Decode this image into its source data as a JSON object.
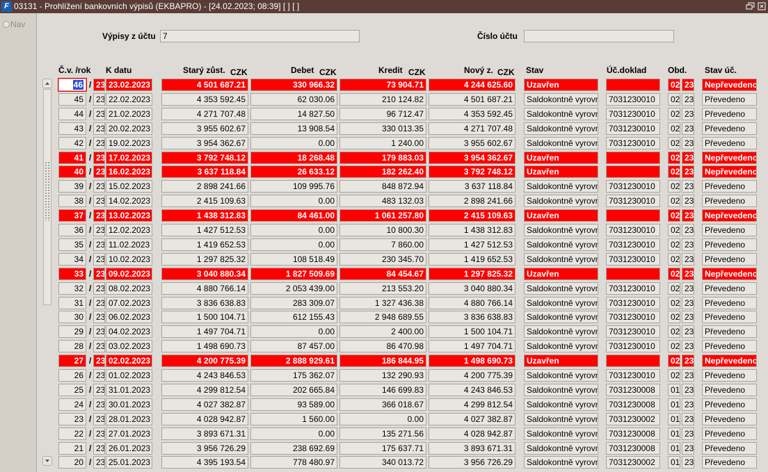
{
  "window": {
    "title": "03131 - Prohlížení bankovních výpisů (EKBAPRO) - [24.02.2023; 08:39]  [ ]  [ ]",
    "app_icon": "F"
  },
  "nav": {
    "label": "Nav"
  },
  "header": {
    "vypisy_label": "Výpisy z účtu",
    "vypisy_value": "7",
    "cislo_label": "Číslo účtu",
    "cislo_value": ""
  },
  "columns": {
    "cv": "Č.v. /rok",
    "kdatu": "K datu",
    "stary": "Starý zůst.",
    "stary_cur": "CZK",
    "debet": "Debet",
    "debet_cur": "CZK",
    "kredit": "Kredit",
    "kredit_cur": "CZK",
    "novy": "Nový z.",
    "novy_cur": "CZK",
    "stav": "Stav",
    "ucdoklad": "Úč.doklad",
    "obd": "Obd.",
    "stavuc": "Stav úč."
  },
  "rows": [
    {
      "cv": "46",
      "rok": "23",
      "date": "23.02.2023",
      "stary": "4 501 687.21",
      "debet": "330 966.32",
      "kredit": "73 904.71",
      "novy": "4 244 625.60",
      "stav": "Uzavřen",
      "doklad": "",
      "obd": "02",
      "obd_rok": "23",
      "stavuc": "Nepřevedeno",
      "hl": true
    },
    {
      "cv": "45",
      "rok": "23",
      "date": "22.02.2023",
      "stary": "4 353 592.45",
      "debet": "62 030.06",
      "kredit": "210 124.82",
      "novy": "4 501 687.21",
      "stav": "Saldokontně vyrovn",
      "doklad": "7031230010",
      "obd": "02",
      "obd_rok": "23",
      "stavuc": "Převedeno",
      "hl": false
    },
    {
      "cv": "44",
      "rok": "23",
      "date": "21.02.2023",
      "stary": "4 271 707.48",
      "debet": "14 827.50",
      "kredit": "96 712.47",
      "novy": "4 353 592.45",
      "stav": "Saldokontně vyrovn",
      "doklad": "7031230010",
      "obd": "02",
      "obd_rok": "23",
      "stavuc": "Převedeno",
      "hl": false
    },
    {
      "cv": "43",
      "rok": "23",
      "date": "20.02.2023",
      "stary": "3 955 602.67",
      "debet": "13 908.54",
      "kredit": "330 013.35",
      "novy": "4 271 707.48",
      "stav": "Saldokontně vyrovn",
      "doklad": "7031230010",
      "obd": "02",
      "obd_rok": "23",
      "stavuc": "Převedeno",
      "hl": false
    },
    {
      "cv": "42",
      "rok": "23",
      "date": "19.02.2023",
      "stary": "3 954 362.67",
      "debet": "0.00",
      "kredit": "1 240.00",
      "novy": "3 955 602.67",
      "stav": "Saldokontně vyrovn",
      "doklad": "7031230010",
      "obd": "02",
      "obd_rok": "23",
      "stavuc": "Převedeno",
      "hl": false
    },
    {
      "cv": "41",
      "rok": "23",
      "date": "17.02.2023",
      "stary": "3 792 748.12",
      "debet": "18 268.48",
      "kredit": "179 883.03",
      "novy": "3 954 362.67",
      "stav": "Uzavřen",
      "doklad": "",
      "obd": "02",
      "obd_rok": "23",
      "stavuc": "Nepřevedeno",
      "hl": true
    },
    {
      "cv": "40",
      "rok": "23",
      "date": "16.02.2023",
      "stary": "3 637 118.84",
      "debet": "26 633.12",
      "kredit": "182 262.40",
      "novy": "3 792 748.12",
      "stav": "Uzavřen",
      "doklad": "",
      "obd": "02",
      "obd_rok": "23",
      "stavuc": "Nepřevedeno",
      "hl": true
    },
    {
      "cv": "39",
      "rok": "23",
      "date": "15.02.2023",
      "stary": "2 898 241.66",
      "debet": "109 995.76",
      "kredit": "848 872.94",
      "novy": "3 637 118.84",
      "stav": "Saldokontně vyrovn",
      "doklad": "7031230010",
      "obd": "02",
      "obd_rok": "23",
      "stavuc": "Převedeno",
      "hl": false
    },
    {
      "cv": "38",
      "rok": "23",
      "date": "14.02.2023",
      "stary": "2 415 109.63",
      "debet": "0.00",
      "kredit": "483 132.03",
      "novy": "2 898 241.66",
      "stav": "Saldokontně vyrovn",
      "doklad": "7031230010",
      "obd": "02",
      "obd_rok": "23",
      "stavuc": "Převedeno",
      "hl": false
    },
    {
      "cv": "37",
      "rok": "23",
      "date": "13.02.2023",
      "stary": "1 438 312.83",
      "debet": "84 461.00",
      "kredit": "1 061 257.80",
      "novy": "2 415 109.63",
      "stav": "Uzavřen",
      "doklad": "",
      "obd": "02",
      "obd_rok": "23",
      "stavuc": "Nepřevedeno",
      "hl": true
    },
    {
      "cv": "36",
      "rok": "23",
      "date": "12.02.2023",
      "stary": "1 427 512.53",
      "debet": "0.00",
      "kredit": "10 800.30",
      "novy": "1 438 312.83",
      "stav": "Saldokontně vyrovn",
      "doklad": "7031230010",
      "obd": "02",
      "obd_rok": "23",
      "stavuc": "Převedeno",
      "hl": false
    },
    {
      "cv": "35",
      "rok": "23",
      "date": "11.02.2023",
      "stary": "1 419 652.53",
      "debet": "0.00",
      "kredit": "7 860.00",
      "novy": "1 427 512.53",
      "stav": "Saldokontně vyrovn",
      "doklad": "7031230010",
      "obd": "02",
      "obd_rok": "23",
      "stavuc": "Převedeno",
      "hl": false
    },
    {
      "cv": "34",
      "rok": "23",
      "date": "10.02.2023",
      "stary": "1 297 825.32",
      "debet": "108 518.49",
      "kredit": "230 345.70",
      "novy": "1 419 652.53",
      "stav": "Saldokontně vyrovn",
      "doklad": "7031230010",
      "obd": "02",
      "obd_rok": "23",
      "stavuc": "Převedeno",
      "hl": false
    },
    {
      "cv": "33",
      "rok": "23",
      "date": "09.02.2023",
      "stary": "3 040 880.34",
      "debet": "1 827 509.69",
      "kredit": "84 454.67",
      "novy": "1 297 825.32",
      "stav": "Uzavřen",
      "doklad": "",
      "obd": "02",
      "obd_rok": "23",
      "stavuc": "Nepřevedeno",
      "hl": true
    },
    {
      "cv": "32",
      "rok": "23",
      "date": "08.02.2023",
      "stary": "4 880 766.14",
      "debet": "2 053 439.00",
      "kredit": "213 553.20",
      "novy": "3 040 880.34",
      "stav": "Saldokontně vyrovn",
      "doklad": "7031230010",
      "obd": "02",
      "obd_rok": "23",
      "stavuc": "Převedeno",
      "hl": false
    },
    {
      "cv": "31",
      "rok": "23",
      "date": "07.02.2023",
      "stary": "3 836 638.83",
      "debet": "283 309.07",
      "kredit": "1 327 436.38",
      "novy": "4 880 766.14",
      "stav": "Saldokontně vyrovn",
      "doklad": "7031230010",
      "obd": "02",
      "obd_rok": "23",
      "stavuc": "Převedeno",
      "hl": false
    },
    {
      "cv": "30",
      "rok": "23",
      "date": "06.02.2023",
      "stary": "1 500 104.71",
      "debet": "612 155.43",
      "kredit": "2 948 689.55",
      "novy": "3 836 638.83",
      "stav": "Saldokontně vyrovn",
      "doklad": "7031230010",
      "obd": "02",
      "obd_rok": "23",
      "stavuc": "Převedeno",
      "hl": false
    },
    {
      "cv": "29",
      "rok": "23",
      "date": "04.02.2023",
      "stary": "1 497 704.71",
      "debet": "0.00",
      "kredit": "2 400.00",
      "novy": "1 500 104.71",
      "stav": "Saldokontně vyrovn",
      "doklad": "7031230010",
      "obd": "02",
      "obd_rok": "23",
      "stavuc": "Převedeno",
      "hl": false
    },
    {
      "cv": "28",
      "rok": "23",
      "date": "03.02.2023",
      "stary": "1 498 690.73",
      "debet": "87 457.00",
      "kredit": "86 470.98",
      "novy": "1 497 704.71",
      "stav": "Saldokontně vyrovn",
      "doklad": "7031230010",
      "obd": "02",
      "obd_rok": "23",
      "stavuc": "Převedeno",
      "hl": false
    },
    {
      "cv": "27",
      "rok": "23",
      "date": "02.02.2023",
      "stary": "4 200 775.39",
      "debet": "2 888 929.61",
      "kredit": "186 844.95",
      "novy": "1 498 690.73",
      "stav": "Uzavřen",
      "doklad": "",
      "obd": "02",
      "obd_rok": "23",
      "stavuc": "Nepřevedeno",
      "hl": true
    },
    {
      "cv": "26",
      "rok": "23",
      "date": "01.02.2023",
      "stary": "4 243 846.53",
      "debet": "175 362.07",
      "kredit": "132 290.93",
      "novy": "4 200 775.39",
      "stav": "Saldokontně vyrovn",
      "doklad": "7031230010",
      "obd": "02",
      "obd_rok": "23",
      "stavuc": "Převedeno",
      "hl": false
    },
    {
      "cv": "25",
      "rok": "23",
      "date": "31.01.2023",
      "stary": "4 299 812.54",
      "debet": "202 665.84",
      "kredit": "146 699.83",
      "novy": "4 243 846.53",
      "stav": "Saldokontně vyrovn",
      "doklad": "7031230008",
      "obd": "01",
      "obd_rok": "23",
      "stavuc": "Převedeno",
      "hl": false
    },
    {
      "cv": "24",
      "rok": "23",
      "date": "30.01.2023",
      "stary": "4 027 382.87",
      "debet": "93 589.00",
      "kredit": "366 018.67",
      "novy": "4 299 812.54",
      "stav": "Saldokontně vyrovn",
      "doklad": "7031230008",
      "obd": "01",
      "obd_rok": "23",
      "stavuc": "Převedeno",
      "hl": false
    },
    {
      "cv": "23",
      "rok": "23",
      "date": "28.01.2023",
      "stary": "4 028 942.87",
      "debet": "1 560.00",
      "kredit": "0.00",
      "novy": "4 027 382.87",
      "stav": "Saldokontně vyrovn",
      "doklad": "7031230002",
      "obd": "01",
      "obd_rok": "23",
      "stavuc": "Převedeno",
      "hl": false
    },
    {
      "cv": "22",
      "rok": "23",
      "date": "27.01.2023",
      "stary": "3 893 671.31",
      "debet": "0.00",
      "kredit": "135 271.56",
      "novy": "4 028 942.87",
      "stav": "Saldokontně vyrovn",
      "doklad": "7031230008",
      "obd": "01",
      "obd_rok": "23",
      "stavuc": "Převedeno",
      "hl": false
    },
    {
      "cv": "21",
      "rok": "23",
      "date": "26.01.2023",
      "stary": "3 956 726.29",
      "debet": "238 692.69",
      "kredit": "175 637.71",
      "novy": "3 893 671.31",
      "stav": "Saldokontně vyrovn",
      "doklad": "7031230008",
      "obd": "01",
      "obd_rok": "23",
      "stavuc": "Převedeno",
      "hl": false
    },
    {
      "cv": "20",
      "rok": "23",
      "date": "25.01.2023",
      "stary": "4 395 193.54",
      "debet": "778 480.97",
      "kredit": "340 013.72",
      "novy": "3 956 726.29",
      "stav": "Saldokontně vyrovn",
      "doklad": "7031230002",
      "obd": "01",
      "obd_rok": "23",
      "stavuc": "Převedeno",
      "hl": false
    }
  ],
  "icons": {
    "restore": "restore-icon",
    "close": "close-icon",
    "scroll_up": "scroll-up-icon",
    "scroll_down": "scroll-down-icon"
  },
  "colors": {
    "titlebar": "#5a3c37",
    "highlight_row": "#ff0000",
    "field_bg": "#e8e6e1",
    "panel_bg": "#dedad5"
  }
}
